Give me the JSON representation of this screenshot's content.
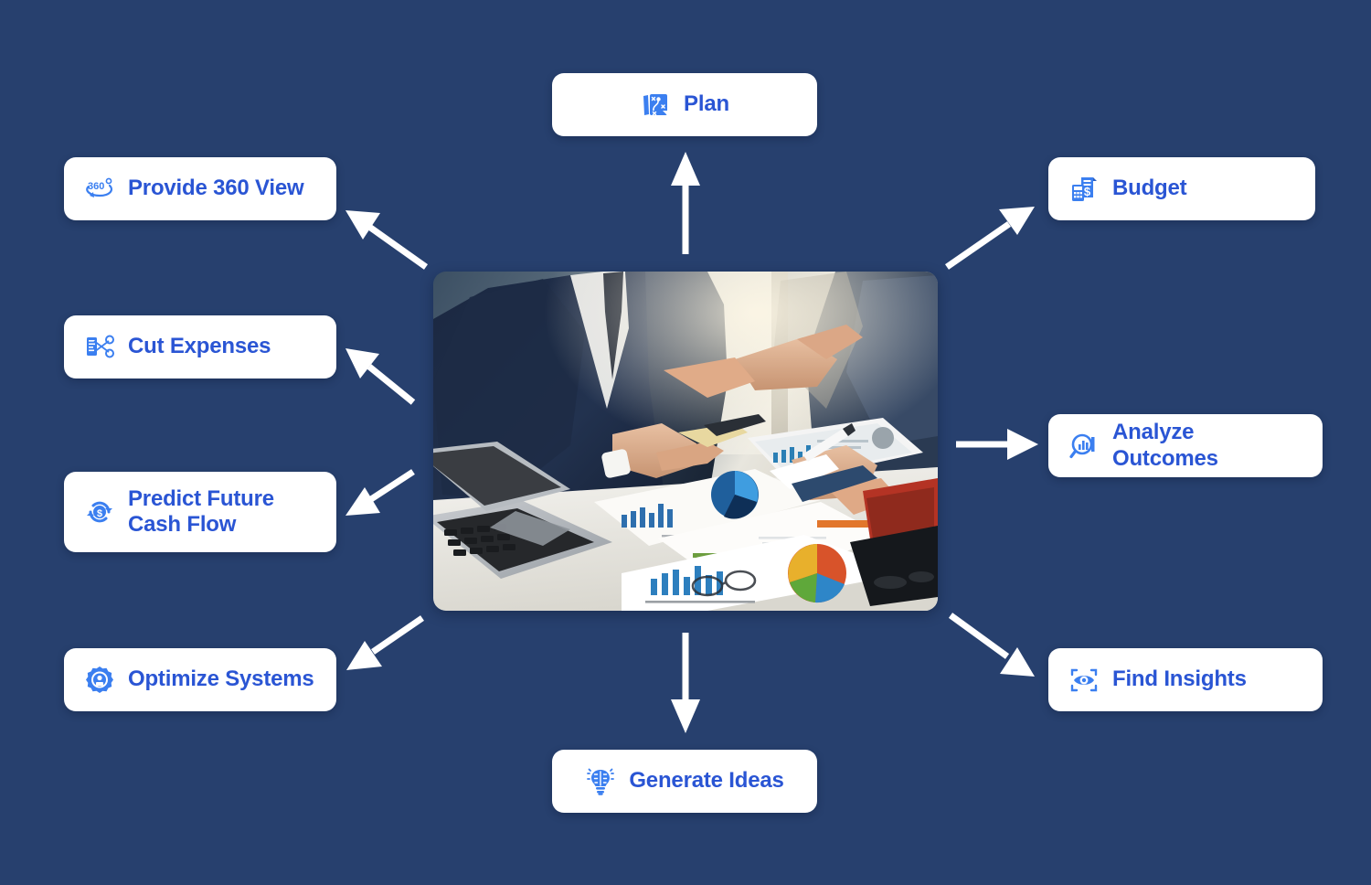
{
  "theme": {
    "background_color": "#27406e",
    "card_background": "#ffffff",
    "label_color": "#2a55d4",
    "icon_color": "#3b7ff0",
    "arrow_color": "#ffffff"
  },
  "diagram": {
    "type": "hub-and-spoke",
    "hub": {
      "name": "center-photo",
      "description": "Photograph of business team reviewing financial charts and a tablet on a desk"
    },
    "nodes": [
      {
        "id": "plan",
        "label": "Plan",
        "icon": "strategy-plan-icon",
        "position": "top",
        "align": "center",
        "arrow": "up"
      },
      {
        "id": "provide-360-view",
        "label": "Provide 360 View",
        "icon": "360-view-icon",
        "position": "left-1",
        "align": "left",
        "arrow": "up-left"
      },
      {
        "id": "budget",
        "label": "Budget",
        "icon": "calculator-invoice-icon",
        "position": "right-1",
        "align": "left",
        "arrow": "up-right"
      },
      {
        "id": "cut-expenses",
        "label": "Cut Expenses",
        "icon": "cut-expenses-icon",
        "position": "left-2",
        "align": "left",
        "arrow": "up-left"
      },
      {
        "id": "predict-cash-flow",
        "label": "Predict Future\nCash Flow",
        "icon": "cash-flow-cycle-icon",
        "position": "left-3",
        "align": "left",
        "arrow": "left"
      },
      {
        "id": "analyze-outcomes",
        "label": "Analyze Outcomes",
        "icon": "magnifier-chart-icon",
        "position": "right-2",
        "align": "left",
        "arrow": "right"
      },
      {
        "id": "optimize-systems",
        "label": "Optimize Systems",
        "icon": "gear-optimize-icon",
        "position": "left-4",
        "align": "left",
        "arrow": "down-left"
      },
      {
        "id": "find-insights",
        "label": "Find Insights",
        "icon": "eye-scan-icon",
        "position": "right-3",
        "align": "left",
        "arrow": "down-right"
      },
      {
        "id": "generate-ideas",
        "label": "Generate Ideas",
        "icon": "brain-bulb-icon",
        "position": "bottom",
        "align": "center",
        "arrow": "down"
      }
    ]
  }
}
